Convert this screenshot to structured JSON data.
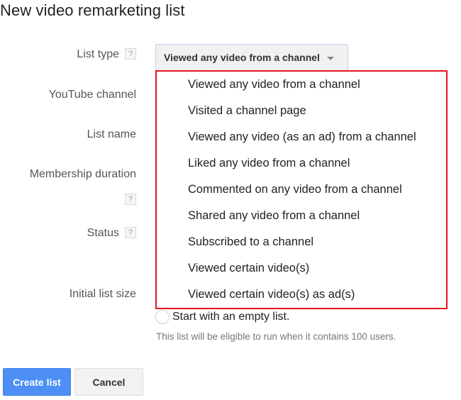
{
  "page": {
    "title": "New video remarketing list"
  },
  "form": {
    "labels": {
      "list_type": "List type",
      "youtube_channel": "YouTube channel",
      "list_name": "List name",
      "membership_duration": "Membership duration",
      "status": "Status",
      "initial_list_size": "Initial list size"
    },
    "help_glyph": "?",
    "list_type_dropdown": {
      "selected": "Viewed any video from a channel",
      "options": [
        "Viewed any video from a channel",
        "Visited a channel page",
        "Viewed any video (as an ad) from a channel",
        "Liked any video from a channel",
        "Commented on any video from a channel",
        "Shared any video from a channel",
        "Subscribed to a channel",
        "Viewed certain video(s)",
        "Viewed certain video(s) as ad(s)"
      ]
    },
    "initial_size": {
      "radio_label": "Start with an empty list.",
      "hint": "This list will be eligible to run when it contains 100 users."
    }
  },
  "actions": {
    "create_label": "Create list",
    "cancel_label": "Cancel"
  },
  "colors": {
    "primary_button": "#4d8ff4",
    "highlight_border": "#e4141e",
    "dropdown_border": "#b9cff0"
  }
}
